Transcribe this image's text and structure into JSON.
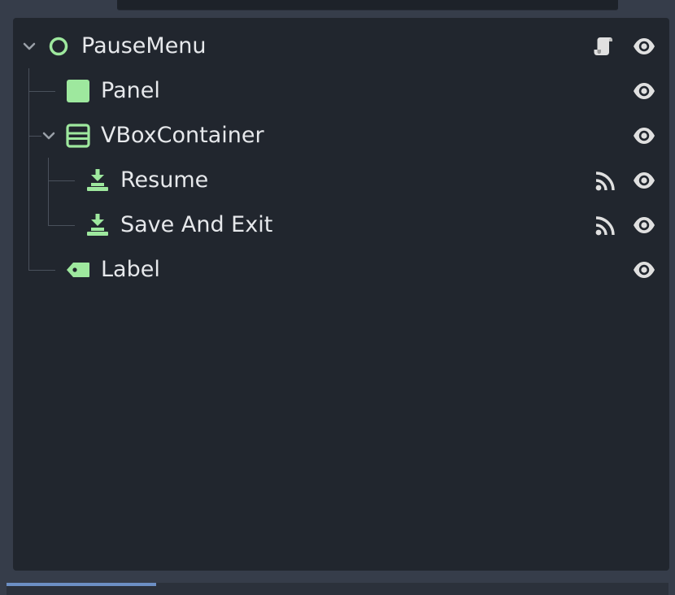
{
  "scene_tree": {
    "nodes": [
      {
        "label": "PauseMenu",
        "type": "Control",
        "collapsed": false,
        "has_script": true,
        "has_signals": false,
        "visible": true
      },
      {
        "label": "Panel",
        "type": "Panel",
        "has_script": false,
        "has_signals": false,
        "visible": true
      },
      {
        "label": "VBoxContainer",
        "type": "VBoxContainer",
        "collapsed": false,
        "has_script": false,
        "has_signals": false,
        "visible": true
      },
      {
        "label": "Resume",
        "type": "Button",
        "has_script": false,
        "has_signals": true,
        "visible": true
      },
      {
        "label": "Save And Exit",
        "type": "Button",
        "has_script": false,
        "has_signals": true,
        "visible": true
      },
      {
        "label": "Label",
        "type": "Label",
        "has_script": false,
        "has_signals": false,
        "visible": true
      }
    ]
  },
  "colors": {
    "panel_bg": "#21262e",
    "frame_bg": "#363d4a",
    "node_green": "#9ee89e",
    "text": "#e6e8eb",
    "icon_gray": "#e0e0e0",
    "guide": "#4a515c",
    "scroll_accent": "#6c8fc4"
  }
}
